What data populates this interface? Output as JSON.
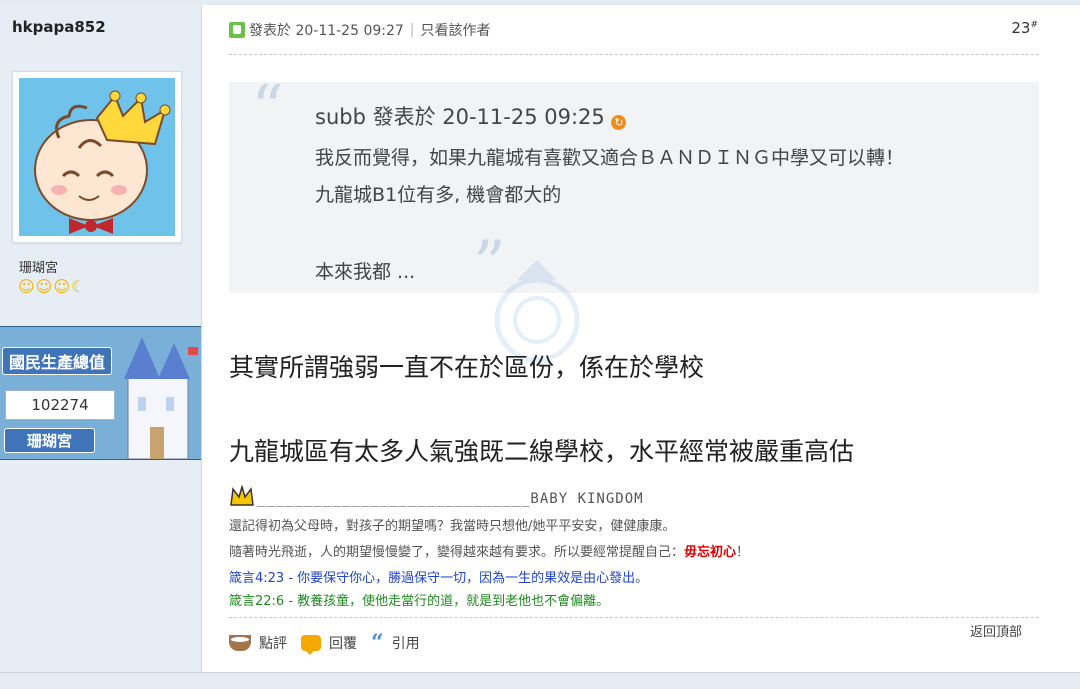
{
  "author": {
    "username": "hkpapa852",
    "rank_title": "珊瑚宮",
    "rank_icons": "☺☺☺☾",
    "banner": {
      "title": "國民生產總值",
      "value": "102274",
      "name": "珊瑚宮"
    }
  },
  "post": {
    "posted_label": "發表於 20-11-25 09:27",
    "author_only_link": "只看該作者",
    "floor": "23",
    "floor_mark": "#",
    "quote": {
      "header": "subb 發表於 20-11-25 09:25",
      "lines": [
        "我反而覺得，如果九龍城有喜歡又適合ＢＡＮＤＩＮＧ中學又可以轉！",
        "九龍城B1位有多, 機會都大的",
        "本來我都 ..."
      ]
    },
    "body": [
      "其實所謂強弱一直不在於區份，係在於學校",
      "九龍城區有太多人氣強既二線學校，水平經常被嚴重高估"
    ],
    "signature": {
      "rule_text": "_____________________________BABY KINGDOM",
      "line1": "還記得初為父母時，對孩子的期望嗎？我當時只想他/她平平安安，健健康康。",
      "line2_prefix": "隨著時光飛逝，人的期望慢慢變了，變得越來越有要求。所以要經常提醒自己：",
      "line2_emphasis": "毋忘初心",
      "line2_suffix": "！",
      "line3": "箴言4:23 - 你要保守你心，勝過保守一切，因為一生的果效是由心發出。",
      "line4": "箴言22:6 - 教養孩童，使他走當行的道，就是到老他也不會偏離。"
    },
    "back_to_top": "返回頂部",
    "actions": {
      "rate": "點評",
      "reply": "回覆",
      "quote": "引用"
    }
  },
  "colors": {
    "sidebar": "#e6edf5",
    "quote_bg": "#f2f3f5",
    "scripture_blue": "#2146c7",
    "scripture_green": "#1f8b1f",
    "emphasis_red": "#e00000"
  }
}
